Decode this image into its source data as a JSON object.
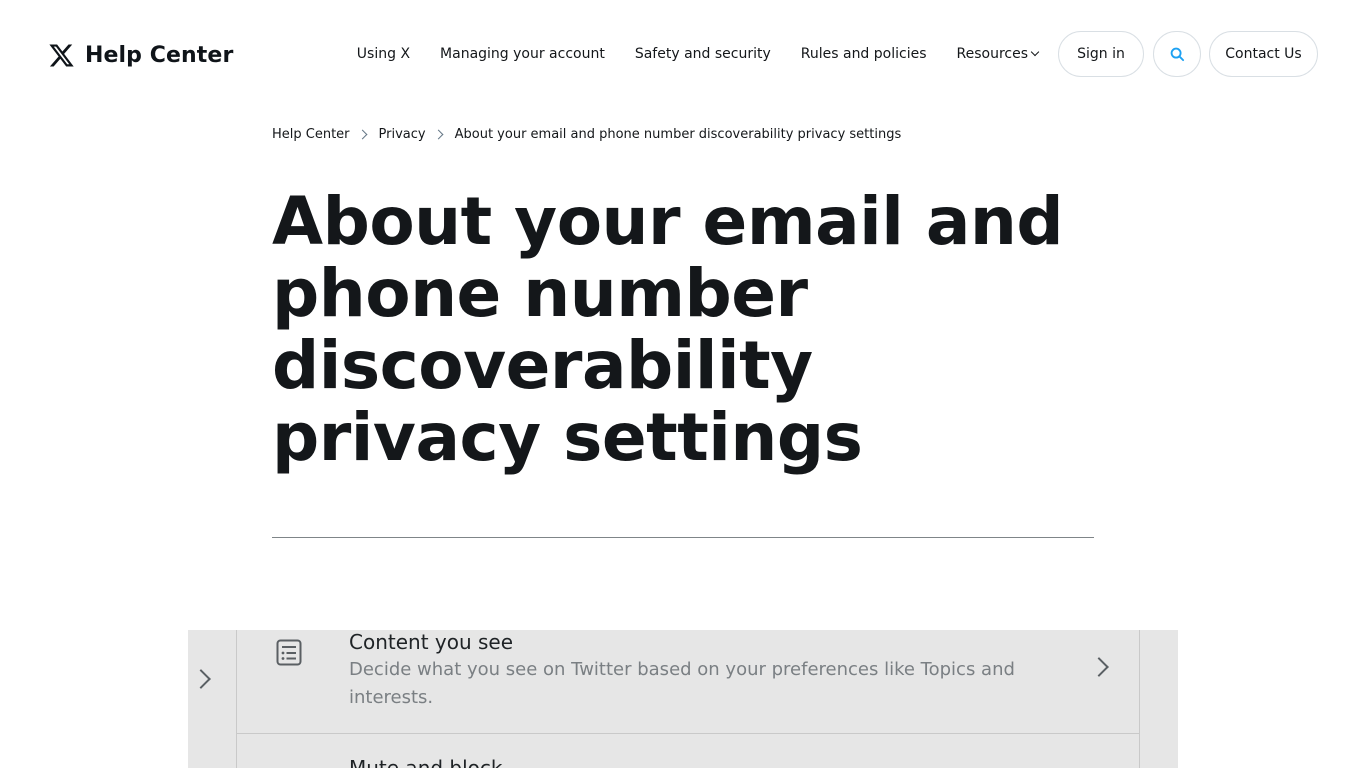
{
  "header": {
    "logo_icon": "x-logo-icon",
    "brand": "Help Center",
    "nav": [
      {
        "label": "Using X"
      },
      {
        "label": "Managing your account"
      },
      {
        "label": "Safety and security"
      },
      {
        "label": "Rules and policies"
      },
      {
        "label": "Resources"
      }
    ],
    "sign_in": "Sign in",
    "search_icon": "search-icon",
    "contact": "Contact Us",
    "accent_color": "#1da1f2"
  },
  "breadcrumb": [
    "Help Center",
    "Privacy",
    "About your email and phone number discoverability privacy settings"
  ],
  "article": {
    "title": "About your email and phone number discoverability privacy settings"
  },
  "embedded_screenshot": {
    "row_title": "Content you see",
    "row_description": "Decide what you see on Twitter based on your preferences like Topics and interests.",
    "next_row_title": "Mute and block"
  }
}
